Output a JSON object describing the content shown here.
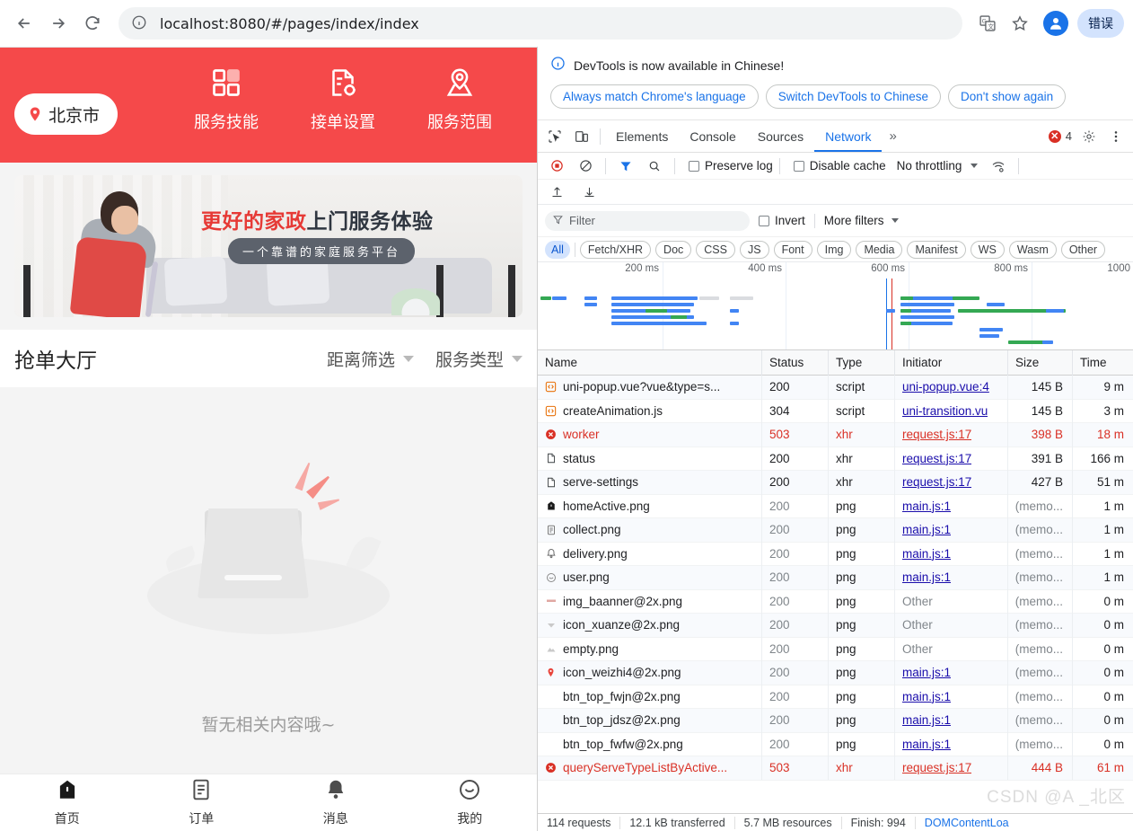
{
  "browser": {
    "url": "localhost:8080/#/pages/index/index",
    "back_icon": "back-arrow-icon",
    "forward_icon": "forward-arrow-icon",
    "reload_icon": "reload-icon",
    "info_icon": "page-info-icon",
    "translate_icon": "translate-icon",
    "bookmark_icon": "star-icon",
    "profile_icon": "profile-avatar-icon",
    "error_chip": "错误"
  },
  "app": {
    "city": "北京市",
    "header_actions": [
      {
        "label": "服务技能",
        "icon": "grid-icon"
      },
      {
        "label": "接单设置",
        "icon": "document-settings-icon"
      },
      {
        "label": "服务范围",
        "icon": "location-pin-icon"
      }
    ],
    "banner": {
      "title_red": "更好的家政",
      "title_dark": "上门服务体验",
      "subtitle": "一个靠谱的家庭服务平台"
    },
    "hall": {
      "title": "抢单大厅",
      "filters": [
        {
          "label": "距离筛选"
        },
        {
          "label": "服务类型"
        }
      ]
    },
    "empty": {
      "text": "暂无相关内容哦~"
    },
    "tabbar": [
      {
        "label": "首页",
        "icon": "home-icon",
        "active": true
      },
      {
        "label": "订单",
        "icon": "order-list-icon",
        "active": false
      },
      {
        "label": "消息",
        "icon": "bell-icon",
        "active": false
      },
      {
        "label": "我的",
        "icon": "smiley-face-icon",
        "active": false
      }
    ]
  },
  "devtools": {
    "notice": {
      "text": "DevTools is now available in Chinese!",
      "info_icon": "info-circle-icon",
      "buttons": [
        "Always match Chrome's language",
        "Switch DevTools to Chinese",
        "Don't show again"
      ]
    },
    "tabs": [
      {
        "label": "Elements",
        "active": false
      },
      {
        "label": "Console",
        "active": false
      },
      {
        "label": "Sources",
        "active": false
      },
      {
        "label": "Network",
        "active": true
      }
    ],
    "more_tabs_icon": "chevron-double-right-icon",
    "inspect_icon": "inspect-element-icon",
    "device_icon": "device-toolbar-icon",
    "settings_icon": "gear-icon",
    "kebab_icon": "three-dot-menu-icon",
    "error_count": "4",
    "toolbar": {
      "record_icon": "record-stop-icon",
      "clear_icon": "clear-no-entry-icon",
      "filter_icon": "funnel-icon",
      "search_icon": "search-icon",
      "preserve_log": "Preserve log",
      "disable_cache": "Disable cache",
      "throttling": "No throttling",
      "wifi_icon": "network-conditions-icon",
      "import_icon": "import-har-icon",
      "export_icon": "export-har-icon"
    },
    "filter": {
      "placeholder": "Filter",
      "invert": "Invert",
      "more_filters": "More filters"
    },
    "type_chips": [
      "All",
      "Fetch/XHR",
      "Doc",
      "CSS",
      "JS",
      "Font",
      "Img",
      "Media",
      "Manifest",
      "WS",
      "Wasm",
      "Other"
    ],
    "overview": {
      "ticks": [
        "200 ms",
        "400 ms",
        "600 ms",
        "800 ms",
        "1000"
      ],
      "dcl_color": "#1a73e8",
      "load_color": "#d93025"
    },
    "columns": [
      "Name",
      "Status",
      "Type",
      "Initiator",
      "Size",
      "Time"
    ],
    "rows": [
      {
        "name": "uni-popup.vue?vue&type=s...",
        "status": "200",
        "type": "script",
        "initiator": "uni-popup.vue:4",
        "size": "145 B",
        "time": "9 m",
        "icon": "script-icon",
        "error": false,
        "memcache": false,
        "link": true
      },
      {
        "name": "createAnimation.js",
        "status": "304",
        "type": "script",
        "initiator": "uni-transition.vu",
        "size": "145 B",
        "time": "3 m",
        "icon": "script-icon",
        "error": false,
        "memcache": false,
        "link": true
      },
      {
        "name": "worker",
        "status": "503",
        "type": "xhr",
        "initiator": "request.js:17",
        "size": "398 B",
        "time": "18 m",
        "icon": "error-icon",
        "error": true,
        "memcache": false,
        "link": true
      },
      {
        "name": "status",
        "status": "200",
        "type": "xhr",
        "initiator": "request.js:17",
        "size": "391 B",
        "time": "166 m",
        "icon": "doc-icon",
        "error": false,
        "memcache": false,
        "link": true
      },
      {
        "name": "serve-settings",
        "status": "200",
        "type": "xhr",
        "initiator": "request.js:17",
        "size": "427 B",
        "time": "51 m",
        "icon": "doc-icon",
        "error": false,
        "memcache": false,
        "link": true
      },
      {
        "name": "homeActive.png",
        "status": "200",
        "type": "png",
        "initiator": "main.js:1",
        "size": "(memo...",
        "time": "1 m",
        "icon": "home-thumb-icon",
        "error": false,
        "memcache": true,
        "link": true
      },
      {
        "name": "collect.png",
        "status": "200",
        "type": "png",
        "initiator": "main.js:1",
        "size": "(memo...",
        "time": "1 m",
        "icon": "list-thumb-icon",
        "error": false,
        "memcache": true,
        "link": true
      },
      {
        "name": "delivery.png",
        "status": "200",
        "type": "png",
        "initiator": "main.js:1",
        "size": "(memo...",
        "time": "1 m",
        "icon": "bell-thumb-icon",
        "error": false,
        "memcache": true,
        "link": true
      },
      {
        "name": "user.png",
        "status": "200",
        "type": "png",
        "initiator": "main.js:1",
        "size": "(memo...",
        "time": "1 m",
        "icon": "smiley-thumb-icon",
        "error": false,
        "memcache": true,
        "link": true
      },
      {
        "name": "img_baanner@2x.png",
        "status": "200",
        "type": "png",
        "initiator": "Other",
        "size": "(memo...",
        "time": "0 m",
        "icon": "banner-thumb-icon",
        "error": false,
        "memcache": true,
        "link": false
      },
      {
        "name": "icon_xuanze@2x.png",
        "status": "200",
        "type": "png",
        "initiator": "Other",
        "size": "(memo...",
        "time": "0 m",
        "icon": "caret-thumb-icon",
        "error": false,
        "memcache": true,
        "link": false
      },
      {
        "name": "empty.png",
        "status": "200",
        "type": "png",
        "initiator": "Other",
        "size": "(memo...",
        "time": "0 m",
        "icon": "empty-thumb-icon",
        "error": false,
        "memcache": true,
        "link": false
      },
      {
        "name": "icon_weizhi4@2x.png",
        "status": "200",
        "type": "png",
        "initiator": "main.js:1",
        "size": "(memo...",
        "time": "0 m",
        "icon": "pin-thumb-icon",
        "error": false,
        "memcache": true,
        "link": true
      },
      {
        "name": "btn_top_fwjn@2x.png",
        "status": "200",
        "type": "png",
        "initiator": "main.js:1",
        "size": "(memo...",
        "time": "0 m",
        "icon": "blank-thumb-icon",
        "error": false,
        "memcache": true,
        "link": true
      },
      {
        "name": "btn_top_jdsz@2x.png",
        "status": "200",
        "type": "png",
        "initiator": "main.js:1",
        "size": "(memo...",
        "time": "0 m",
        "icon": "blank-thumb-icon",
        "error": false,
        "memcache": true,
        "link": true
      },
      {
        "name": "btn_top_fwfw@2x.png",
        "status": "200",
        "type": "png",
        "initiator": "main.js:1",
        "size": "(memo...",
        "time": "0 m",
        "icon": "blank-thumb-icon",
        "error": false,
        "memcache": true,
        "link": true
      },
      {
        "name": "queryServeTypeListByActive...",
        "status": "503",
        "type": "xhr",
        "initiator": "request.js:17",
        "size": "444 B",
        "time": "61 m",
        "icon": "error-icon",
        "error": true,
        "memcache": false,
        "link": true
      }
    ],
    "status_bar": [
      "114 requests",
      "12.1 kB transferred",
      "5.7 MB resources",
      "Finish: 994",
      "DOMContentLoa"
    ],
    "watermark": "CSDN @A _北区"
  }
}
